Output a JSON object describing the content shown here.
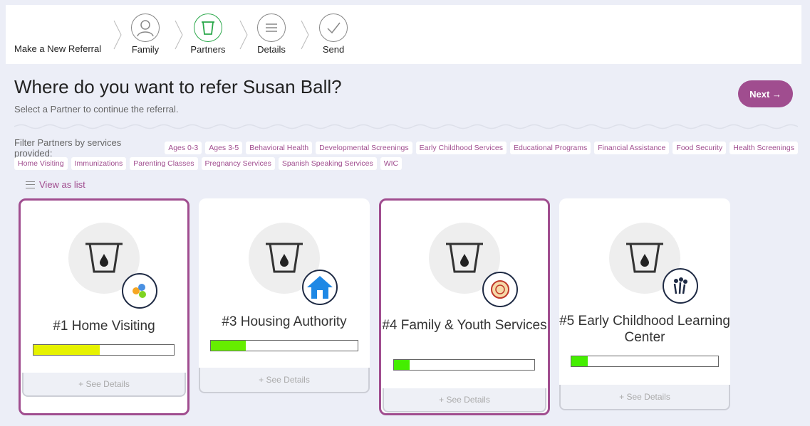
{
  "wizard": {
    "title": "Make a New Referral",
    "steps": [
      {
        "label": "Family",
        "icon": "person-icon"
      },
      {
        "label": "Partners",
        "icon": "bucket-icon"
      },
      {
        "label": "Details",
        "icon": "list-icon"
      },
      {
        "label": "Send",
        "icon": "check-icon"
      }
    ],
    "active_step": "Partners"
  },
  "page": {
    "heading": "Where do you want to refer Susan Ball?",
    "subheading": "Select a Partner to continue the referral.",
    "next_label": "Next →"
  },
  "filters": {
    "label": "Filter Partners by services provided:",
    "tags": [
      "Ages 0-3",
      "Ages 3-5",
      "Behavioral Health",
      "Developmental Screenings",
      "Early Childhood Services",
      "Educational Programs",
      "Financial Assistance",
      "Food Security",
      "Health Screenings",
      "Home Visiting",
      "Immunizations",
      "Parenting Classes",
      "Pregnancy Services",
      "Spanish Speaking Services",
      "WIC"
    ]
  },
  "view_toggle": {
    "label": "View as list",
    "icon": "list-lines-icon"
  },
  "partners": [
    {
      "name": "#1 Home Visiting",
      "selected": true,
      "progress": 0.47,
      "bar_color": "#e6f200",
      "badge_icon": "circles-logo-icon",
      "details_label": "+ See Details"
    },
    {
      "name": "#3 Housing Authority",
      "selected": false,
      "progress": 0.24,
      "bar_color": "#66ee00",
      "badge_icon": "house-icon",
      "details_label": "+ See Details"
    },
    {
      "name": "#4 Family & Youth Services",
      "selected": true,
      "progress": 0.11,
      "bar_color": "#44ee00",
      "badge_icon": "seal-logo-icon",
      "details_label": "+ See Details"
    },
    {
      "name": "#5 Early Childhood Learning Center",
      "selected": false,
      "progress": 0.11,
      "bar_color": "#44ee00",
      "badge_icon": "people-logo-icon",
      "details_label": "+ See Details"
    }
  ],
  "colors": {
    "accent": "#a04d8f",
    "active_step": "#2aa84a",
    "page_bg": "#eceef7"
  }
}
